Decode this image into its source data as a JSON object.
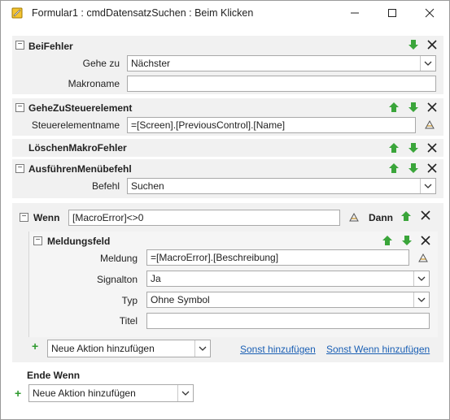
{
  "window": {
    "title": "Formular1 : cmdDatensatzSuchen : Beim Klicken"
  },
  "beifehler": {
    "header": "BeiFehler",
    "goto_label": "Gehe zu",
    "goto_value": "Nächster",
    "macro_label": "Makroname",
    "macro_value": ""
  },
  "gehezu": {
    "header": "GeheZuSteuerelement",
    "control_label": "Steuerelementname",
    "control_value": "=[Screen].[PreviousControl].[Name]"
  },
  "loeschen": {
    "header": "LöschenMakroFehler"
  },
  "ausfuehren": {
    "header": "AusführenMenübefehl",
    "cmd_label": "Befehl",
    "cmd_value": "Suchen"
  },
  "wenn": {
    "header": "Wenn",
    "condition": "[MacroError]<>0",
    "then_label": "Dann"
  },
  "meldung": {
    "header": "Meldungsfeld",
    "msg_label": "Meldung",
    "msg_value": "=[MacroError].[Beschreibung]",
    "beep_label": "Signalton",
    "beep_value": "Ja",
    "type_label": "Typ",
    "type_value": "Ohne Symbol",
    "title_label": "Titel",
    "title_value": ""
  },
  "inner_add": {
    "value": "Neue Aktion hinzufügen",
    "else_link": "Sonst hinzufügen",
    "elseif_link": "Sonst Wenn hinzufügen"
  },
  "endif": {
    "label": "Ende Wenn"
  },
  "outer_add": {
    "value": "Neue Aktion hinzufügen"
  },
  "colors": {
    "up_arrow": "#3aa53a",
    "down_arrow": "#3aa53a",
    "link": "#1a5fb4",
    "section_bg": "#f1f1f1"
  }
}
